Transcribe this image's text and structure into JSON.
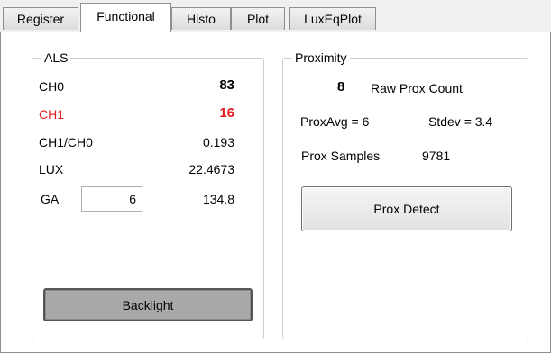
{
  "tabs": [
    "Register",
    "Functional",
    "Histo",
    "Plot",
    "LuxEqPlot"
  ],
  "active_tab": "Functional",
  "als": {
    "title": "ALS",
    "ch0_label": "CH0",
    "ch0_value": "83",
    "ch1_label": "CH1",
    "ch1_value": "16",
    "ratio_label": "CH1/CH0",
    "ratio_value": "0.193",
    "lux_label": "LUX",
    "lux_value": "22.4673",
    "ga_label": "GA",
    "ga_input": "6",
    "ga_value": "134.8",
    "backlight_label": "Backlight"
  },
  "proximity": {
    "title": "Proximity",
    "raw_count": "8",
    "raw_count_label": "Raw Prox Count",
    "prox_avg": "ProxAvg = 6",
    "stdev": "Stdev = 3.4",
    "samples_label": "Prox Samples",
    "samples_value": "9781",
    "detect_label": "Prox Detect"
  },
  "colors": {
    "ch1_red": "#e31b1b",
    "group_border": "#c9d0d5",
    "backlight_button": "#a9a9a9"
  }
}
